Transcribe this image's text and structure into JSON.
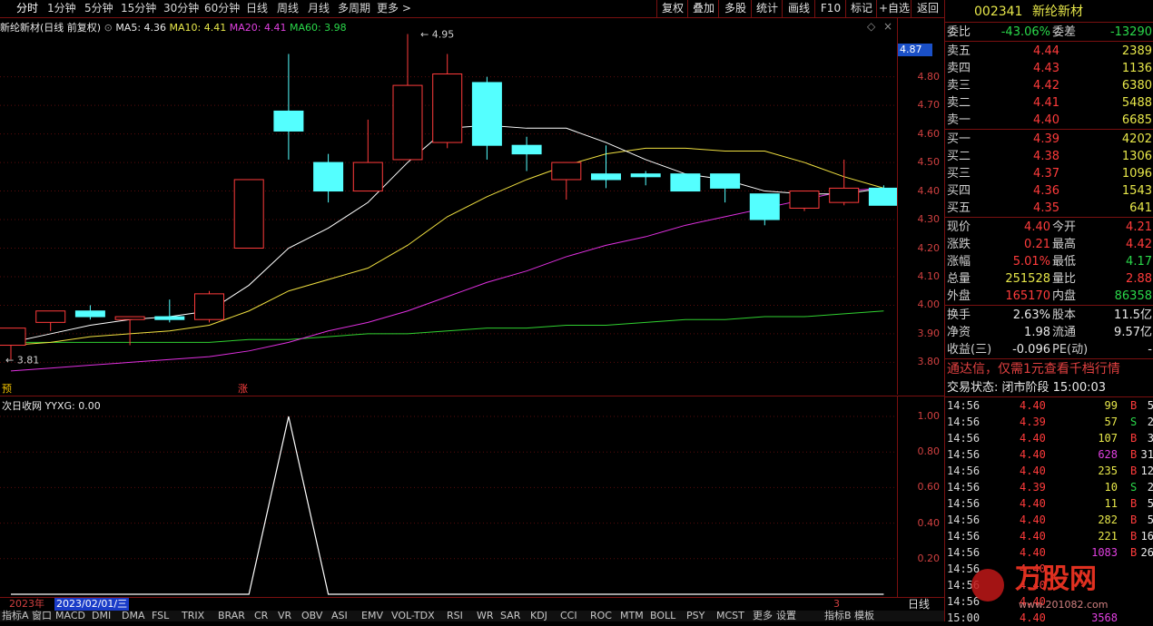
{
  "toolbar": {
    "periods": [
      "分时",
      "1分钟",
      "5分钟",
      "15分钟",
      "30分钟",
      "60分钟",
      "日线",
      "周线",
      "月线",
      "多周期",
      "更多"
    ],
    "buttons": [
      "复权",
      "叠加",
      "多股",
      "统计",
      "画线",
      "F10",
      "标记",
      "+自选",
      "返回"
    ]
  },
  "chart_header": {
    "title": "新纶新材(日线 前复权)",
    "ma5": "MA5: 4.36",
    "ma10": "MA10: 4.41",
    "ma20": "MA20: 4.41",
    "ma60": "MA60: 3.98"
  },
  "colors": {
    "up": "#ff3b3b",
    "down": "#54ffff",
    "ma5": "#ffffff",
    "ma10": "#f0e040",
    "ma20": "#e030e0",
    "ma60": "#30d030",
    "frame": "#7a1010"
  },
  "price_axis": {
    "current": "4.87",
    "ticks": [
      "4.80",
      "4.70",
      "4.60",
      "4.50",
      "4.40",
      "4.30",
      "4.20",
      "4.10",
      "4.00",
      "3.90",
      "3.80"
    ]
  },
  "annotations": {
    "high": "4.95",
    "low": "3.81",
    "marker_yu": "预",
    "marker_zhang": "涨"
  },
  "chart_data": {
    "type": "candlestick",
    "ylim": [
      3.76,
      4.98
    ],
    "candles": [
      {
        "o": 3.86,
        "h": 3.92,
        "l": 3.81,
        "c": 3.92
      },
      {
        "o": 3.94,
        "h": 3.98,
        "l": 3.91,
        "c": 3.98
      },
      {
        "o": 3.98,
        "h": 4.0,
        "l": 3.95,
        "c": 3.96
      },
      {
        "o": 3.95,
        "h": 3.96,
        "l": 3.86,
        "c": 3.96
      },
      {
        "o": 3.96,
        "h": 4.02,
        "l": 3.94,
        "c": 3.95
      },
      {
        "o": 3.95,
        "h": 4.05,
        "l": 3.94,
        "c": 4.04
      },
      {
        "o": 4.2,
        "h": 4.44,
        "l": 4.2,
        "c": 4.44
      },
      {
        "o": 4.68,
        "h": 4.88,
        "l": 4.51,
        "c": 4.61
      },
      {
        "o": 4.5,
        "h": 4.53,
        "l": 4.36,
        "c": 4.4
      },
      {
        "o": 4.4,
        "h": 4.65,
        "l": 4.4,
        "c": 4.5
      },
      {
        "o": 4.51,
        "h": 4.95,
        "l": 4.51,
        "c": 4.77
      },
      {
        "o": 4.57,
        "h": 4.88,
        "l": 4.55,
        "c": 4.81
      },
      {
        "o": 4.78,
        "h": 4.8,
        "l": 4.51,
        "c": 4.56
      },
      {
        "o": 4.56,
        "h": 4.59,
        "l": 4.47,
        "c": 4.53
      },
      {
        "o": 4.44,
        "h": 4.5,
        "l": 4.37,
        "c": 4.5
      },
      {
        "o": 4.46,
        "h": 4.56,
        "l": 4.41,
        "c": 4.44
      },
      {
        "o": 4.46,
        "h": 4.47,
        "l": 4.42,
        "c": 4.45
      },
      {
        "o": 4.46,
        "h": 4.46,
        "l": 4.4,
        "c": 4.4
      },
      {
        "o": 4.46,
        "h": 4.46,
        "l": 4.36,
        "c": 4.41
      },
      {
        "o": 4.39,
        "h": 4.39,
        "l": 4.28,
        "c": 4.3
      },
      {
        "o": 4.34,
        "h": 4.4,
        "l": 4.33,
        "c": 4.4
      },
      {
        "o": 4.36,
        "h": 4.51,
        "l": 4.35,
        "c": 4.41
      },
      {
        "o": 4.41,
        "h": 4.42,
        "l": 4.35,
        "c": 4.35
      }
    ],
    "ma5": [
      3.87,
      3.9,
      3.93,
      3.95,
      3.96,
      3.98,
      4.07,
      4.2,
      4.27,
      4.36,
      4.5,
      4.62,
      4.63,
      4.62,
      4.62,
      4.57,
      4.51,
      4.46,
      4.44,
      4.4,
      4.39,
      4.39,
      4.41
    ],
    "ma10": [
      3.86,
      3.87,
      3.89,
      3.9,
      3.91,
      3.93,
      3.98,
      4.05,
      4.09,
      4.13,
      4.21,
      4.31,
      4.38,
      4.44,
      4.49,
      4.53,
      4.55,
      4.55,
      4.54,
      4.54,
      4.5,
      4.45,
      4.41
    ],
    "ma20": [
      3.77,
      3.78,
      3.79,
      3.8,
      3.81,
      3.82,
      3.84,
      3.87,
      3.91,
      3.94,
      3.98,
      4.03,
      4.08,
      4.12,
      4.17,
      4.21,
      4.24,
      4.28,
      4.31,
      4.34,
      4.37,
      4.4,
      4.41
    ],
    "ma60": [
      3.87,
      3.87,
      3.87,
      3.87,
      3.87,
      3.87,
      3.88,
      3.88,
      3.89,
      3.9,
      3.9,
      3.91,
      3.92,
      3.92,
      3.93,
      3.93,
      3.94,
      3.95,
      3.95,
      3.96,
      3.96,
      3.97,
      3.98
    ]
  },
  "sub_chart": {
    "title": "次日收网",
    "value": "YYXG: 0.00",
    "ticks": [
      "1.00",
      "0.80",
      "0.60",
      "0.40",
      "0.20"
    ],
    "signal": [
      0,
      0,
      0,
      0,
      0,
      0,
      0,
      1,
      0,
      0,
      0,
      0,
      0,
      0,
      0,
      0,
      0,
      0,
      0,
      0,
      0,
      0,
      0
    ]
  },
  "date_bar": {
    "year": "2023年",
    "selected": "2023/02/01/三",
    "mark": "3",
    "period": "日线"
  },
  "indicator_tabs": [
    "指标A",
    "窗口",
    "MACD",
    "DMI",
    "DMA",
    "FSL",
    "TRIX",
    "BRAR",
    "CR",
    "VR",
    "OBV",
    "ASI",
    "EMV",
    "VOL-TDX",
    "RSI",
    "WR",
    "SAR",
    "KDJ",
    "CCI",
    "ROC",
    "MTM",
    "BOLL",
    "PSY",
    "MCST",
    "更多",
    "设置",
    "指标B",
    "模板"
  ],
  "panel": {
    "code": "002341",
    "name": "新纶新材",
    "weibi_label": "委比",
    "weibi": "-43.06%",
    "weicha_label": "委差",
    "weicha": "-13290",
    "asks": [
      {
        "label": "卖五",
        "price": "4.44",
        "vol": "2389"
      },
      {
        "label": "卖四",
        "price": "4.43",
        "vol": "1136"
      },
      {
        "label": "卖三",
        "price": "4.42",
        "vol": "6380"
      },
      {
        "label": "卖二",
        "price": "4.41",
        "vol": "5488"
      },
      {
        "label": "卖一",
        "price": "4.40",
        "vol": "6685"
      }
    ],
    "bids": [
      {
        "label": "买一",
        "price": "4.39",
        "vol": "4202"
      },
      {
        "label": "买二",
        "price": "4.38",
        "vol": "1306"
      },
      {
        "label": "买三",
        "price": "4.37",
        "vol": "1096"
      },
      {
        "label": "买四",
        "price": "4.36",
        "vol": "1543"
      },
      {
        "label": "买五",
        "price": "4.35",
        "vol": "641"
      }
    ],
    "stats": [
      {
        "l1": "现价",
        "v1": "4.40",
        "c1": "red",
        "l2": "今开",
        "v2": "4.21",
        "c2": "red"
      },
      {
        "l1": "涨跌",
        "v1": "0.21",
        "c1": "red",
        "l2": "最高",
        "v2": "4.42",
        "c2": "red"
      },
      {
        "l1": "涨幅",
        "v1": "5.01%",
        "c1": "red",
        "l2": "最低",
        "v2": "4.17",
        "c2": "green"
      },
      {
        "l1": "总量",
        "v1": "251528",
        "c1": "yellow",
        "l2": "量比",
        "v2": "2.88",
        "c2": "red"
      },
      {
        "l1": "外盘",
        "v1": "165170",
        "c1": "red",
        "l2": "内盘",
        "v2": "86358",
        "c2": "green"
      }
    ],
    "stats2": [
      {
        "l1": "换手",
        "v1": "2.63%",
        "l2": "股本",
        "v2": "11.5亿"
      },
      {
        "l1": "净资",
        "v1": "1.98",
        "l2": "流通",
        "v2": "9.57亿"
      },
      {
        "l1": "收益(三)",
        "v1": "-0.096",
        "l2": "PE(动)",
        "v2": "-"
      }
    ],
    "ad": "通达信，仅需1元查看千档行情",
    "status": "交易状态: 闭市阶段 15:00:03",
    "ticks": [
      {
        "t": "14:56",
        "p": "4.40",
        "pc": "red",
        "v": "99",
        "vc": "yellow",
        "s": "B",
        "sc": "red",
        "n": "5"
      },
      {
        "t": "14:56",
        "p": "4.39",
        "pc": "red",
        "v": "57",
        "vc": "yellow",
        "s": "S",
        "sc": "green",
        "n": "2"
      },
      {
        "t": "14:56",
        "p": "4.40",
        "pc": "red",
        "v": "107",
        "vc": "yellow",
        "s": "B",
        "sc": "red",
        "n": "3"
      },
      {
        "t": "14:56",
        "p": "4.40",
        "pc": "red",
        "v": "628",
        "vc": "magenta",
        "s": "B",
        "sc": "red",
        "n": "31"
      },
      {
        "t": "14:56",
        "p": "4.40",
        "pc": "red",
        "v": "235",
        "vc": "yellow",
        "s": "B",
        "sc": "red",
        "n": "12"
      },
      {
        "t": "14:56",
        "p": "4.39",
        "pc": "red",
        "v": "10",
        "vc": "yellow",
        "s": "S",
        "sc": "green",
        "n": "2"
      },
      {
        "t": "14:56",
        "p": "4.40",
        "pc": "red",
        "v": "11",
        "vc": "yellow",
        "s": "B",
        "sc": "red",
        "n": "5"
      },
      {
        "t": "14:56",
        "p": "4.40",
        "pc": "red",
        "v": "282",
        "vc": "yellow",
        "s": "B",
        "sc": "red",
        "n": "5"
      },
      {
        "t": "14:56",
        "p": "4.40",
        "pc": "red",
        "v": "221",
        "vc": "yellow",
        "s": "B",
        "sc": "red",
        "n": "16"
      },
      {
        "t": "14:56",
        "p": "4.40",
        "pc": "red",
        "v": "1083",
        "vc": "magenta",
        "s": "B",
        "sc": "red",
        "n": "26"
      },
      {
        "t": "14:56",
        "p": "4.40",
        "pc": "red",
        "v": "",
        "vc": "yellow",
        "s": "",
        "sc": "red",
        "n": ""
      },
      {
        "t": "14:56",
        "p": "4.40",
        "pc": "red",
        "v": "",
        "vc": "yellow",
        "s": "",
        "sc": "red",
        "n": ""
      },
      {
        "t": "14:56",
        "p": "4.40",
        "pc": "red",
        "v": "",
        "vc": "yellow",
        "s": "",
        "sc": "red",
        "n": ""
      },
      {
        "t": "15:00",
        "p": "4.40",
        "pc": "red",
        "v": "3568",
        "vc": "magenta",
        "s": "",
        "sc": "red",
        "n": ""
      }
    ],
    "watermark_cn": "万股网",
    "watermark_url": "www.201082.com"
  }
}
